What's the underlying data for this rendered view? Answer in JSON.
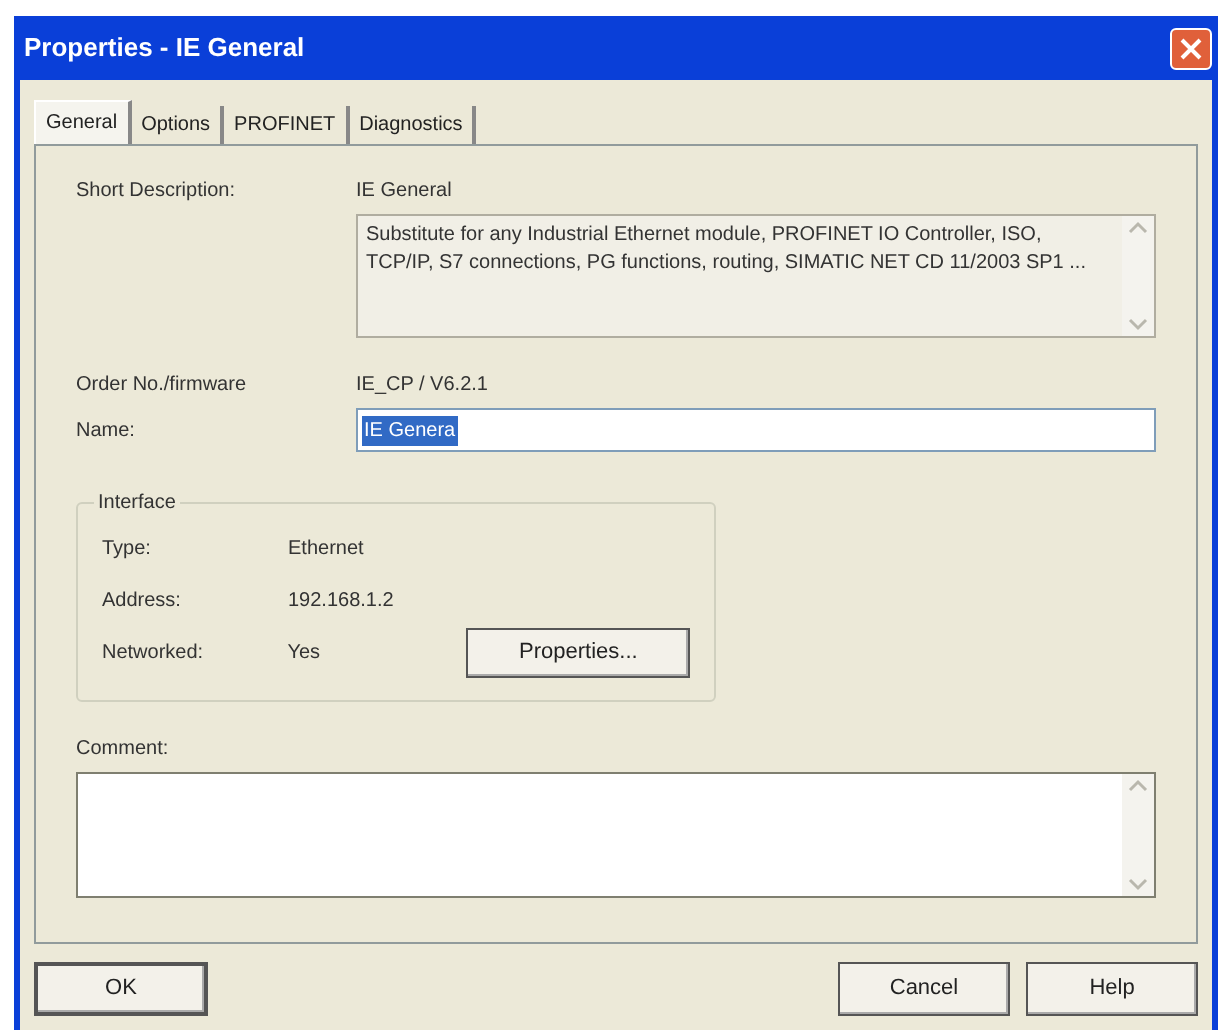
{
  "window": {
    "title": "Properties - IE General"
  },
  "tabs": [
    {
      "label": "General",
      "selected": true
    },
    {
      "label": "Options",
      "selected": false
    },
    {
      "label": "PROFINET",
      "selected": false
    },
    {
      "label": "Diagnostics",
      "selected": false
    }
  ],
  "general": {
    "short_description_label": "Short Description:",
    "short_description": "IE General",
    "description": "Substitute for any Industrial Ethernet module, PROFINET IO Controller, ISO, TCP/IP, S7 connections, PG functions, routing, SIMATIC NET CD 11/2003 SP1 ...",
    "order_label": "Order No./firmware",
    "order": "IE_CP / V6.2.1",
    "name_label": "Name:",
    "name_value": "IE Genera",
    "name_highlighted": true
  },
  "interface": {
    "title": "Interface",
    "rows": [
      {
        "label": "Type:",
        "value": "Ethernet"
      },
      {
        "label": "Address:",
        "value": "192.168.1.2"
      },
      {
        "label": "Networked:",
        "value": "Yes"
      }
    ],
    "button": "Properties..."
  },
  "comment": {
    "label": "Comment:"
  },
  "buttons": {
    "ok": "OK",
    "cancel": "Cancel",
    "help": "Help"
  }
}
